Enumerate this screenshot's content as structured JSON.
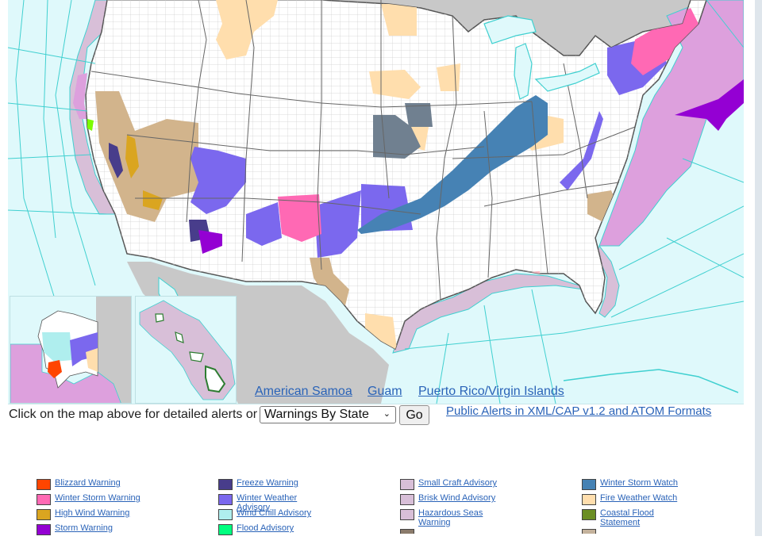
{
  "map": {
    "colors": {
      "ocean": "#dff9fb",
      "land_foreign": "#c8c8c8",
      "land_us": "#ffffff",
      "county_line": "#c0c0c0",
      "state_line": "#555555",
      "marine_zone_line": "#40d0d0"
    },
    "links": [
      {
        "label": "American Samoa"
      },
      {
        "label": "Guam"
      },
      {
        "label": "Puerto Rico/Virgin Islands"
      }
    ],
    "insets": [
      {
        "name": "Alaska"
      },
      {
        "name": "Hawaii"
      }
    ]
  },
  "controls": {
    "hint": "Click on the map above for detailed alerts or",
    "select_value": "Warnings By State",
    "go_label": "Go",
    "xml_link": "Public Alerts in XML/CAP v1.2 and ATOM Formats"
  },
  "legend": {
    "columns": [
      [
        {
          "label": "Blizzard Warning",
          "color": "#ff4500"
        },
        {
          "label": "Winter Storm Warning",
          "color": "#ff69b4"
        },
        {
          "label": "High Wind Warning",
          "color": "#daa520"
        },
        {
          "label": "Storm Warning",
          "color": "#9400d3"
        }
      ],
      [
        {
          "label": "Freeze Warning",
          "color": "#483d8b"
        },
        {
          "label": "Winter Weather Advisory",
          "color": "#7b68ee"
        },
        {
          "label": "Wind Chill Advisory",
          "color": "#afeeee"
        },
        {
          "label": "Flood Advisory",
          "color": "#00ff7f"
        }
      ],
      [
        {
          "label": "Small Craft Advisory",
          "color": "#d8bfd8"
        },
        {
          "label": "Brisk Wind Advisory",
          "color": "#d8bfd8"
        },
        {
          "label": "Hazardous Seas Warning",
          "color": "#d8bfd8"
        }
      ],
      [
        {
          "label": "Winter Storm Watch",
          "color": "#4682b4"
        },
        {
          "label": "Fire Weather Watch",
          "color": "#ffdead"
        },
        {
          "label": "Coastal Flood Statement",
          "color": "#6b8e23"
        }
      ]
    ],
    "partial_swatches": [
      "#8b7b6b",
      "#c4b29c"
    ]
  },
  "alert_colors": {
    "wind_advisory": "#d2b48c",
    "gale_warning": "#dda0dd",
    "hard_freeze_watch": "#708090",
    "dense_fog": "#7cfc00",
    "red_flag": "#ffb6c1"
  }
}
